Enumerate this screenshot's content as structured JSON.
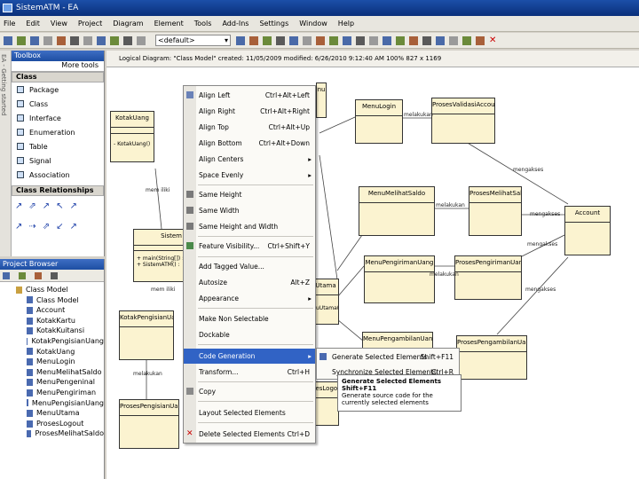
{
  "window": {
    "title": "SistemATM - EA"
  },
  "menu": [
    "File",
    "Edit",
    "View",
    "Project",
    "Diagram",
    "Element",
    "Tools",
    "Add-Ins",
    "Settings",
    "Window",
    "Help"
  ],
  "toolbar": {
    "perspective": "<default>"
  },
  "toolbox": {
    "title": "Toolbox",
    "more": "More tools",
    "side_tab": "EA - Getting started",
    "class_group": "Class",
    "items": [
      "Package",
      "Class",
      "Interface",
      "Enumeration",
      "Table",
      "Signal",
      "Association"
    ],
    "relationships_group": "Class Relationships"
  },
  "browser": {
    "title": "Project Browser",
    "items": [
      "Class Model",
      "Class Model",
      "Account",
      "KotakKartu",
      "KotakKuitansi",
      "KotakPengisianUang",
      "KotakUang",
      "MenuLogin",
      "MenuMelihatSaldo",
      "MenuPengeninal",
      "MenuPengiriman",
      "MenuPengisianUang",
      "MenuUtama",
      "ProsesLogout",
      "ProsesMelihatSaldo"
    ]
  },
  "diagram": {
    "header": "Logical Diagram: \"Class Model\" created: 11/05/2009 modified: 6/26/2010 9:12:40 AM 100% 827 x 1169",
    "classes": {
      "kotak_uang": {
        "name": "KotakUang",
        "attr": "- KotakUang()"
      },
      "sistem": {
        "name": "Sistem",
        "attr1": "+ main(String[]) :",
        "attr2": "+ SistemATM() :"
      },
      "kotak_pengisian": {
        "name": "KotakPengisianUang"
      },
      "proses_pengisian": {
        "name": "ProsesPengisianUang"
      },
      "menu_login": {
        "name": "MenuLogin"
      },
      "proses_validasi": {
        "name": "ProsesValidasiAccount"
      },
      "menu_melihat": {
        "name": "MenuMelihatSaldo"
      },
      "proses_melihat": {
        "name": "ProsesMelihatSaldo"
      },
      "account": {
        "name": "Account"
      },
      "menu_pengiriman": {
        "name": "MenuPengirimanUang"
      },
      "proses_pengiriman": {
        "name": "ProsesPengirimanUang"
      },
      "menu_pengambilan": {
        "name": "MenuPengambilanUang"
      },
      "proses_pengambilan": {
        "name": "ProsesPengambilanUang"
      },
      "menu_utama": {
        "name": "Utama",
        "attr": "uUtama()"
      },
      "proses_logout": {
        "name": "sesLogo"
      },
      "top_partial": {
        "name": "nu"
      }
    },
    "labels": {
      "melakukan1": "melakukan",
      "melakukan2": "melakukan",
      "melakukan3": "melakukan",
      "melakukan4": "melakukan",
      "mengakses1": "mengakses",
      "mengakses2": "mengakses",
      "mengakses3": "mengakses",
      "mengakses4": "mengakses",
      "mem1": "mem iliki",
      "mem2": "mem iliki"
    }
  },
  "context_menu": {
    "items": [
      {
        "label": "Align Left",
        "shortcut": "Ctrl+Alt+Left"
      },
      {
        "label": "Align Right",
        "shortcut": "Ctrl+Alt+Right"
      },
      {
        "label": "Align Top",
        "shortcut": "Ctrl+Alt+Up"
      },
      {
        "label": "Align Bottom",
        "shortcut": "Ctrl+Alt+Down"
      },
      {
        "label": "Align Centers",
        "shortcut": ""
      },
      {
        "label": "Space Evenly",
        "shortcut": ""
      },
      {
        "label": "Same Height",
        "shortcut": ""
      },
      {
        "label": "Same Width",
        "shortcut": ""
      },
      {
        "label": "Same Height and Width",
        "shortcut": ""
      },
      {
        "label": "Feature Visibility...",
        "shortcut": "Ctrl+Shift+Y"
      },
      {
        "label": "Add Tagged Value...",
        "shortcut": ""
      },
      {
        "label": "Autosize",
        "shortcut": "Alt+Z"
      },
      {
        "label": "Appearance",
        "shortcut": ""
      },
      {
        "label": "Make Non Selectable",
        "shortcut": ""
      },
      {
        "label": "Dockable",
        "shortcut": ""
      },
      {
        "label": "Code Generation",
        "shortcut": ""
      },
      {
        "label": "Transform...",
        "shortcut": "Ctrl+H"
      },
      {
        "label": "Copy",
        "shortcut": ""
      },
      {
        "label": "Layout Selected Elements",
        "shortcut": ""
      },
      {
        "label": "Delete Selected Elements",
        "shortcut": "Ctrl+D"
      }
    ]
  },
  "submenu": {
    "items": [
      {
        "label": "Generate Selected Elements",
        "shortcut": "Shift+F11"
      },
      {
        "label": "Synchronize Selected Elements",
        "shortcut": "Ctrl+R"
      }
    ]
  },
  "tooltip": {
    "title": "Generate Selected Elements",
    "shortcut": "Shift+F11",
    "text": "Generate source code for the currently selected elements"
  }
}
